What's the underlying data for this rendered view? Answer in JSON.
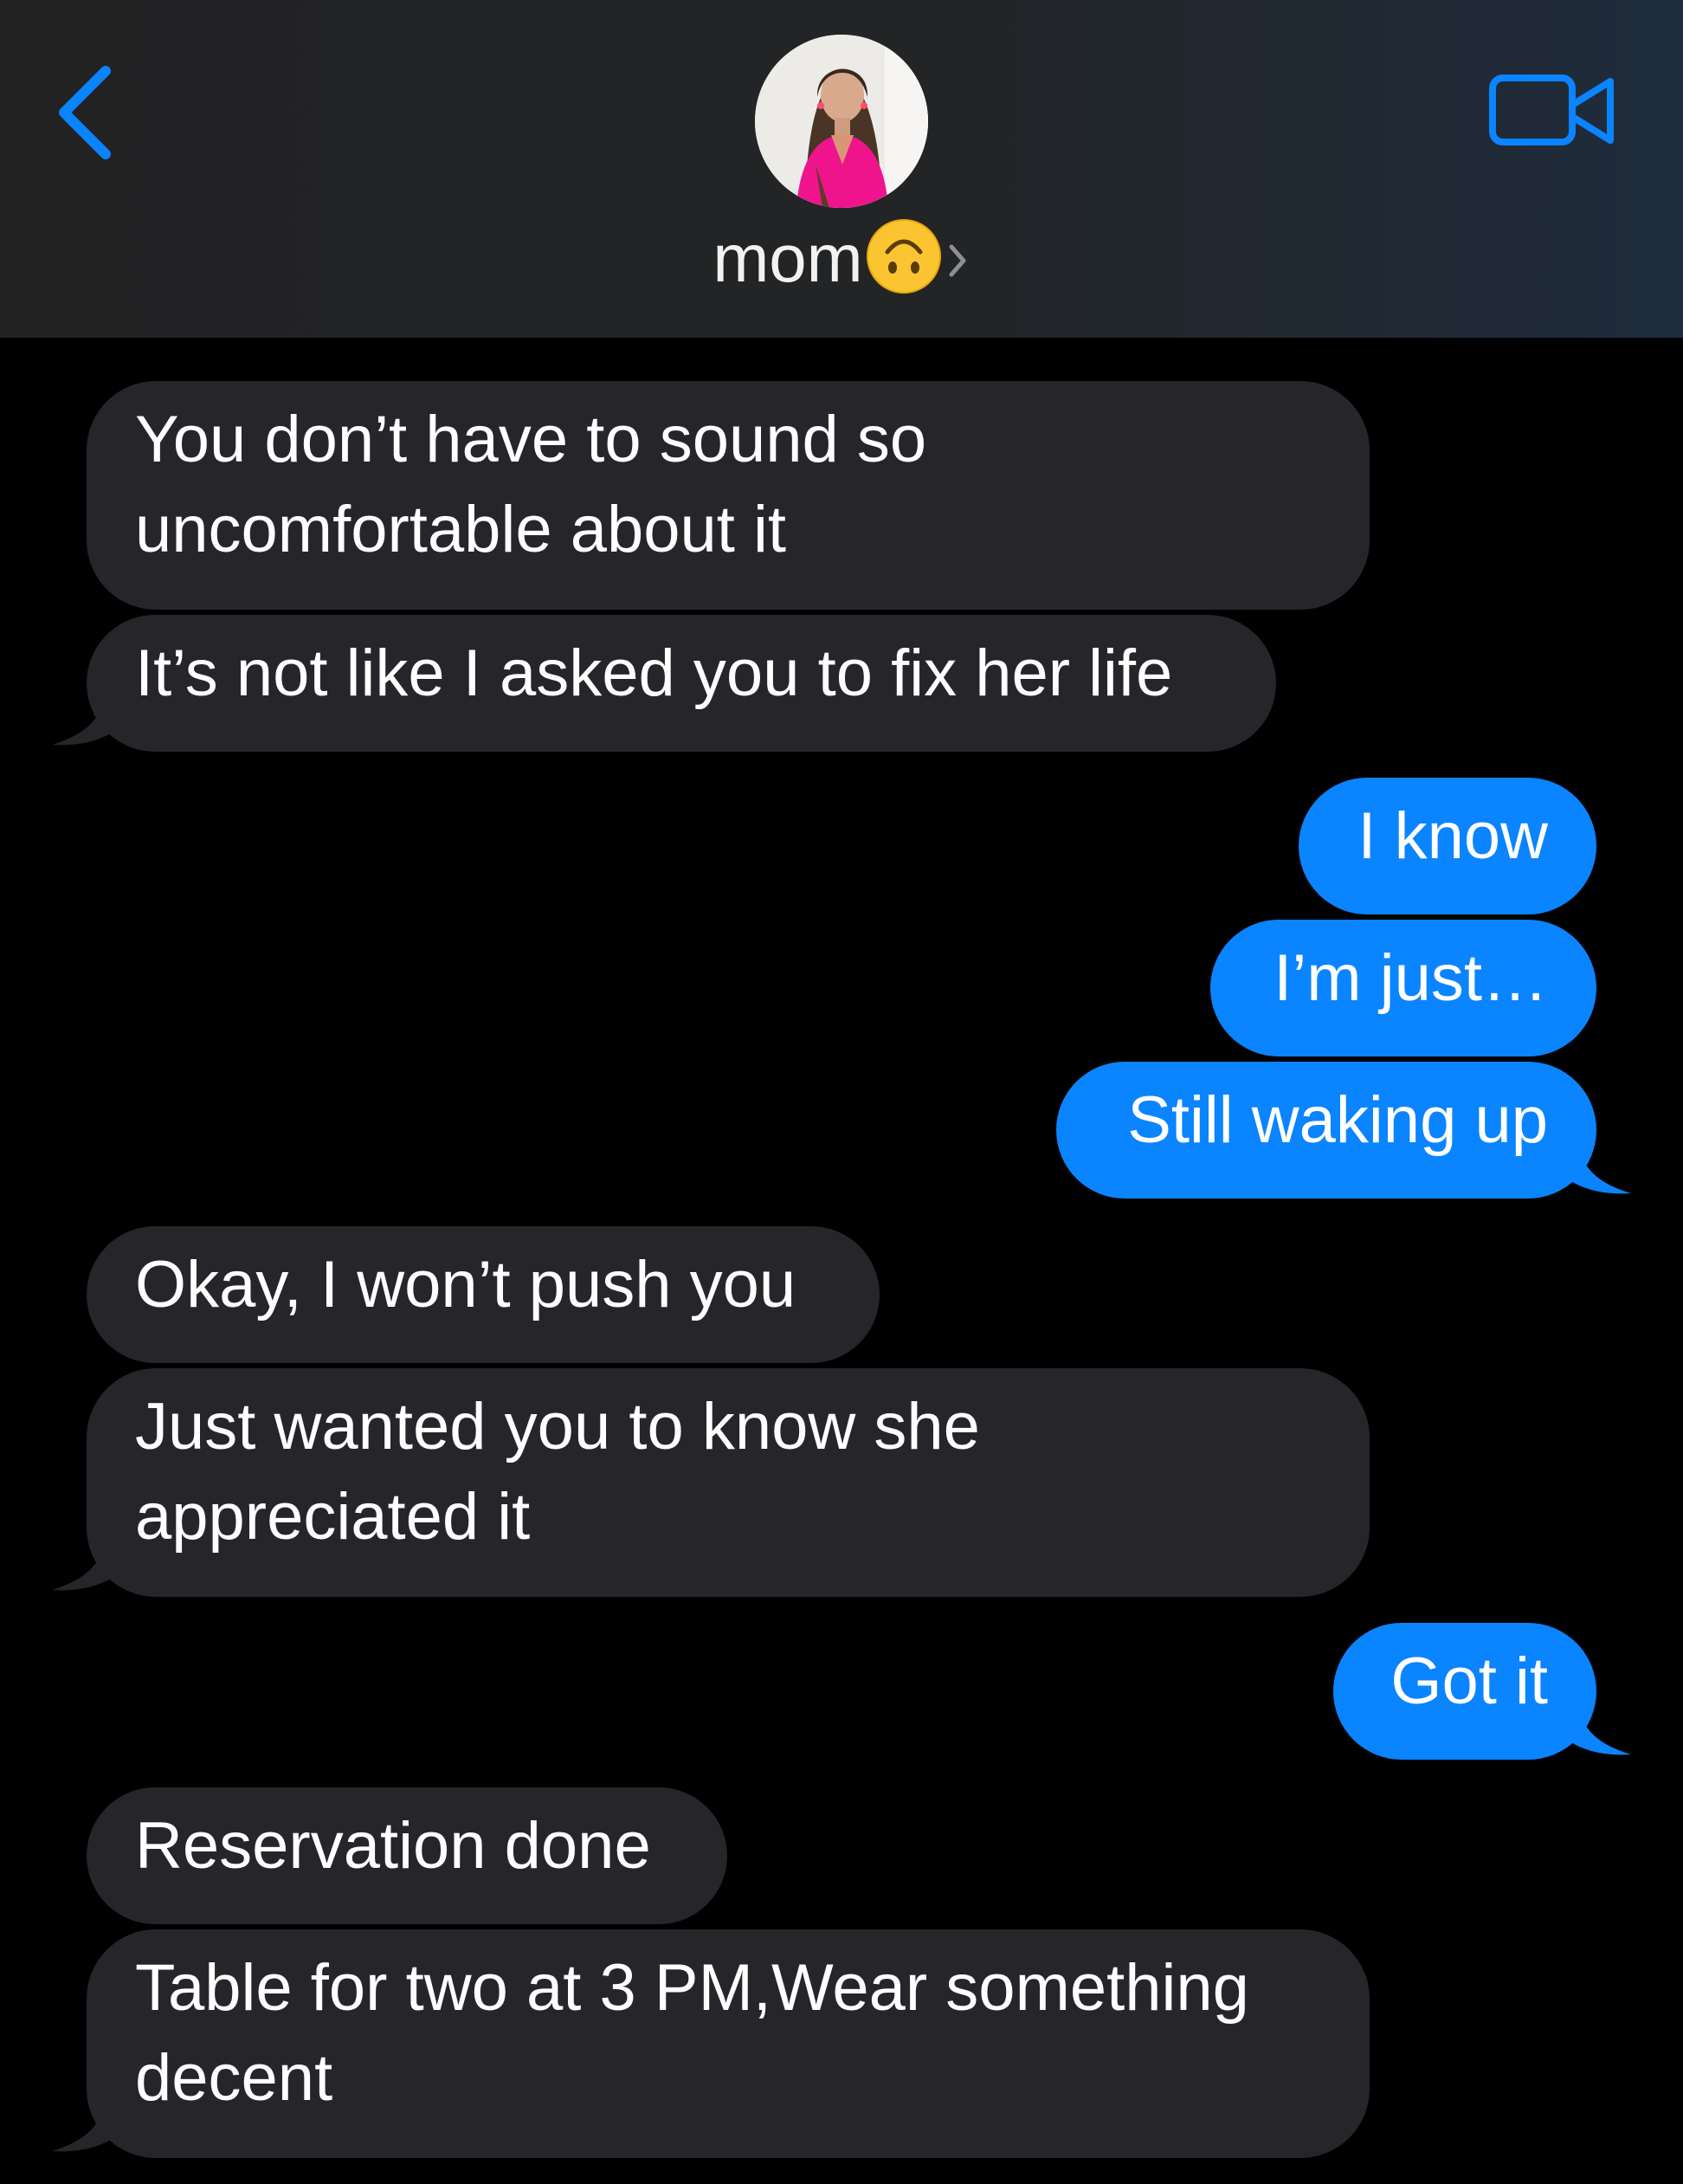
{
  "header": {
    "back_icon": "chevron-left-icon",
    "contact_name": "mom",
    "contact_emoji": "upside-down-face-emoji",
    "disclosure_icon": "chevron-right-icon",
    "video_icon": "video-camera-icon",
    "accent_color": "#0a84ff"
  },
  "messages": [
    {
      "direction": "incoming",
      "lines": [
        "You don’t have to sound so",
        "uncomfortable about it"
      ]
    },
    {
      "direction": "incoming",
      "lines": [
        "It’s not like I asked you to fix her life"
      ]
    },
    {
      "direction": "outgoing",
      "lines": [
        "I know"
      ]
    },
    {
      "direction": "outgoing",
      "lines": [
        "I’m just…"
      ]
    },
    {
      "direction": "outgoing",
      "lines": [
        "Still waking up"
      ]
    },
    {
      "direction": "incoming",
      "lines": [
        "Okay, I won’t push you"
      ]
    },
    {
      "direction": "incoming",
      "lines": [
        "Just wanted you to know she",
        "appreciated it"
      ]
    },
    {
      "direction": "outgoing",
      "lines": [
        "Got it"
      ]
    },
    {
      "direction": "incoming",
      "lines": [
        "Reservation done"
      ]
    },
    {
      "direction": "incoming",
      "lines": [
        "Table for two at 3 PM,Wear something",
        "decent"
      ]
    }
  ],
  "colors": {
    "incoming_bubble": "#26262a",
    "outgoing_bubble": "#0a84ff",
    "background": "#000000"
  }
}
